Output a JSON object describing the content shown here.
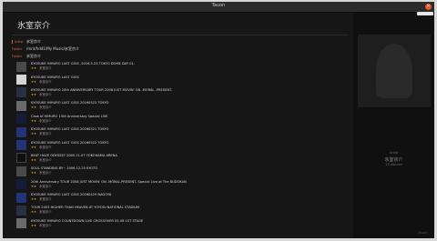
{
  "window": {
    "title": "Tauon"
  },
  "page": {
    "title": "氷室京介"
  },
  "meta": [
    {
      "key": "Artist",
      "value": "氷室京介"
    },
    {
      "key": "Folder",
      "value": "/mnt/hdd1/My Music/氷室京介"
    },
    {
      "key": "Folder",
      "value": "氷室京介"
    }
  ],
  "items": [
    {
      "title": "KYOSUKE HIMURO LAST GIGS -2016.5.23 TOKYO DOME DAY 01-",
      "artist": "氷室京介",
      "rating": "★★"
    },
    {
      "title": "KYOSUKE HIMURO LAST GIGS",
      "artist": "氷室京介",
      "rating": "★★"
    },
    {
      "title": "KYOSUKE HIMURO 20th ANNIVERSARY TOUR 2008 JUST MOVIN' ON -MORAL -PRESENT-",
      "artist": "氷室京介",
      "rating": "★★"
    },
    {
      "title": "KYOSUKE HIMURO LAST GIGS 20160523 TOKYO",
      "artist": "氷室京介",
      "rating": "★★"
    },
    {
      "title": "Case of HIMURO 15th Anniversary Special LIVE",
      "artist": "氷室京介",
      "rating": "★★"
    },
    {
      "title": "KYOSUKE HIMURO LAST GIGS 20160521 TOKYO",
      "artist": "氷室京介",
      "rating": "★★"
    },
    {
      "title": "KYOSUKE HIMURO LAST GIGS 20160522 TOKYO",
      "artist": "氷室京介",
      "rating": "★★"
    },
    {
      "title": "BEAT HAZE ODYSSEY 2000.11.07 YOKOHAMA ARENA",
      "artist": "氷室京介",
      "rating": "★★"
    },
    {
      "title": "SOUL STANDING BY~ 2006.12.25 KYOTO",
      "artist": "氷室京介",
      "rating": "★★"
    },
    {
      "title": "20th Anniversary TOUR 2008 JUST MOVIN' ON -MORAL-PRESENT- Special Live at The BUDOKAN",
      "artist": "氷室京介",
      "rating": "★★"
    },
    {
      "title": "KYOSUKE HIMURO LAST GIGS 20160429 NAGOYA",
      "artist": "氷室京介",
      "rating": "★★"
    },
    {
      "title": "TOUR 2003 HIGHER THAN HEAVEN AT YOYOGI NATIONAL STADIUM",
      "artist": "氷室京介",
      "rating": "★★"
    },
    {
      "title": "KYOSUKE HIMURO COUNTDOWN LIVE CROSSOVER 05-06 1ST STAGE",
      "artist": "氷室京介",
      "rating": "★★"
    }
  ],
  "side": {
    "sub": "Artist",
    "name": "氷室京介",
    "sub2": "13 albums",
    "foot": "Tauon"
  },
  "colors": {
    "accent": "#e0603f",
    "star": "#d0a020"
  }
}
